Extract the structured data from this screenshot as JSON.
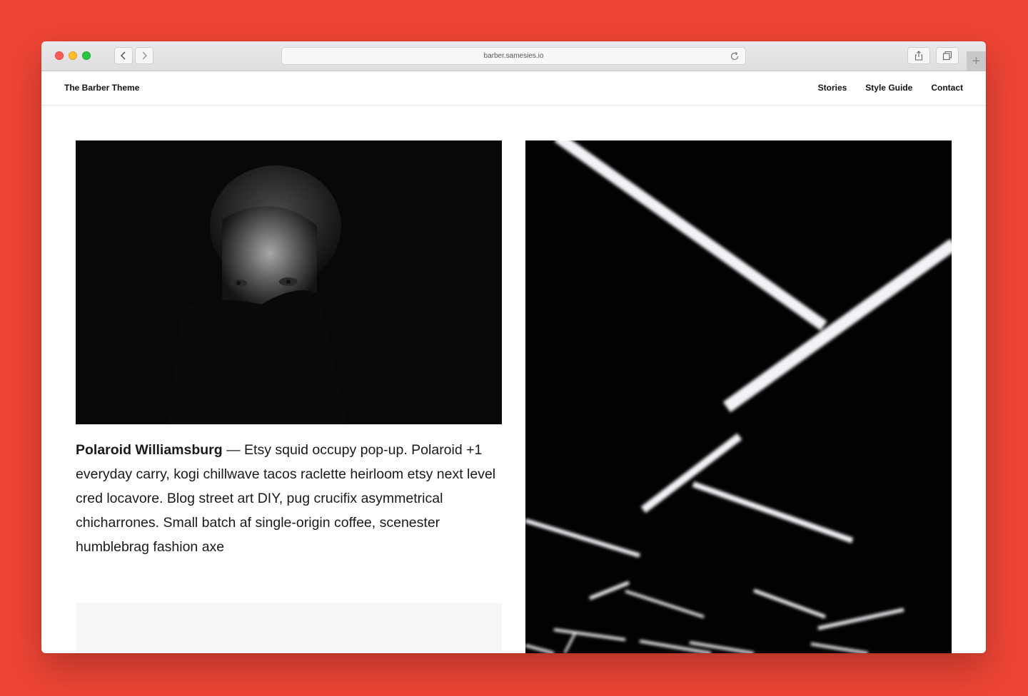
{
  "browser": {
    "url": "barber.samesies.io",
    "new_tab_label": "+"
  },
  "site": {
    "brand": "The Barber Theme",
    "nav": [
      {
        "label": "Stories"
      },
      {
        "label": "Style Guide"
      },
      {
        "label": "Contact"
      }
    ]
  },
  "posts": {
    "first": {
      "title": "Polaroid Williamsburg",
      "separator": " — ",
      "excerpt": "Etsy squid occupy pop-up. Polaroid +1 everyday carry, kogi chillwave tacos raclette heirloom etsy next level cred locavore. Blog street art DIY, pug crucifix asymmetrical chicharrones. Small batch af single-origin coffee, scenester humblebrag fashion axe"
    }
  },
  "colors": {
    "background": "#ee4535",
    "text": "#1a1a1a"
  },
  "icons": {
    "back": "chevron-left-icon",
    "forward": "chevron-right-icon",
    "reload": "reload-icon",
    "share": "share-icon",
    "tabs": "tabs-icon"
  }
}
